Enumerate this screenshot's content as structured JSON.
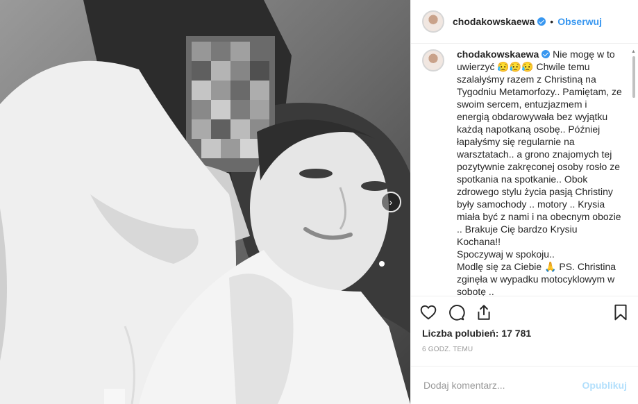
{
  "post": {
    "username": "chodakowskaewa",
    "follow_label": "Obserwuj",
    "separator": "•"
  },
  "caption": {
    "username": "chodakowskaewa",
    "text": " Nie mogę w to uwierzyć 😥😥😥 Chwile temu szalałyśmy razem z Christiną na Tygodniu Metamorfozy.. Pamiętam, ze swoim sercem, entuzjazmem i energią obdarowywała bez wyjątku każdą napotkaną osobę.. Później łapałyśmy się regularnie na warsztatach.. a grono znajomych tej pozytywnie zakręconej osoby rosło ze spotkania na spotkanie.. Obok zdrowego stylu życia pasją Christiny były samochody .. motory .. Krysia miała być z nami i na obecnym obozie .. Brakuje Cię bardzo Krysiu Kochana!!\nSpoczywaj w spokoju..\nModlę się za Ciebie 🙏 PS. Christina zginęła w wypadku motocyklowym w sobotę .."
  },
  "actions": {
    "like_icon": "heart-icon",
    "comment_icon": "comment-icon",
    "share_icon": "share-icon",
    "save_icon": "bookmark-icon"
  },
  "likes": {
    "label": "Liczba polubień: 17 781"
  },
  "timestamp": "6 godz. temu",
  "comment_box": {
    "placeholder": "Dodaj komentarz...",
    "publish_label": "Opublikuj"
  },
  "photo": {
    "next_icon": "chevron-right-icon",
    "next_glyph": "›"
  },
  "colors": {
    "link_blue": "#3897f0",
    "publish_disabled": "#b2dffc",
    "border": "#efefef",
    "text": "#262626",
    "muted": "#999999"
  }
}
